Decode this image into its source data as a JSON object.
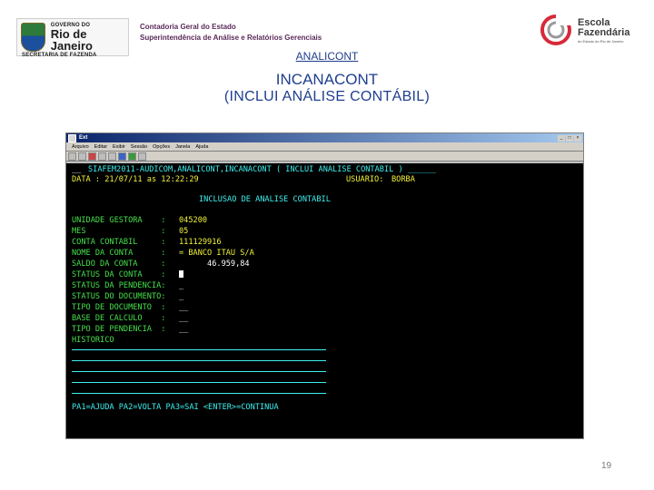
{
  "header": {
    "gov_small": "GOVERNO DO",
    "gov_big": "Rio de Janeiro",
    "secretaria": "SECRETARIA DE FAZENDA",
    "line1": "Contadoria Geral do Estado",
    "line2": "Superintendência de Análise e Relatórios Gerenciais",
    "escola_1": "Escola",
    "escola_2": "Fazendária",
    "escola_3": "do Estado do Rio de Janeiro"
  },
  "slide": {
    "link": "ANALICONT",
    "title": "INCANACONT",
    "subtitle": "(INCLUI  ANÁLISE  CONTÁBIL)",
    "page_number": "19"
  },
  "window": {
    "title": "Ext",
    "menus": [
      "Arquivo",
      "Editar",
      "Exibir",
      "Sessão",
      "Opções",
      "Janela",
      "Ajuda"
    ]
  },
  "terminal": {
    "header_prefix": "__",
    "header_title": "SIAFEM2011-AUDICOM,ANALICONT,INCANACONT ( INCLUI ANALISE CONTABIL ) ______",
    "data_label": "DATA : 21/07/11 as 12:22:29",
    "usuario_label": "USUARIO:",
    "usuario_value": "BORBA",
    "screen_title": "INCLUSAO DE ANALISE CONTABIL",
    "fields": [
      {
        "label": "UNIDADE GESTORA    :",
        "value": "045200"
      },
      {
        "label": "MES                :",
        "value": "05"
      },
      {
        "label": "CONTA CONTABIL     :",
        "value": "111129916"
      },
      {
        "label": "NOME DA CONTA      :",
        "value": "= BANCO ITAU S/A"
      },
      {
        "label": "SALDO DA CONTA     :",
        "value": "      46.959,84"
      },
      {
        "label": "STATUS DA CONTA    :",
        "value": ""
      },
      {
        "label": "STATUS DA PENDENCIA:",
        "value": "_"
      },
      {
        "label": "STATUS DO DOCUMENTO:",
        "value": "_"
      },
      {
        "label": "TIPO DE DOCUMENTO  :",
        "value": "__"
      },
      {
        "label": "BASE DE CALCULO    :",
        "value": "__"
      },
      {
        "label": "TIPO DE PENDENCIA  :",
        "value": "__"
      }
    ],
    "historico_label": "HISTORICO",
    "function_keys": "PA1=AJUDA PA2=VOLTA PA3=SAI <ENTER>=CONTINUA"
  }
}
